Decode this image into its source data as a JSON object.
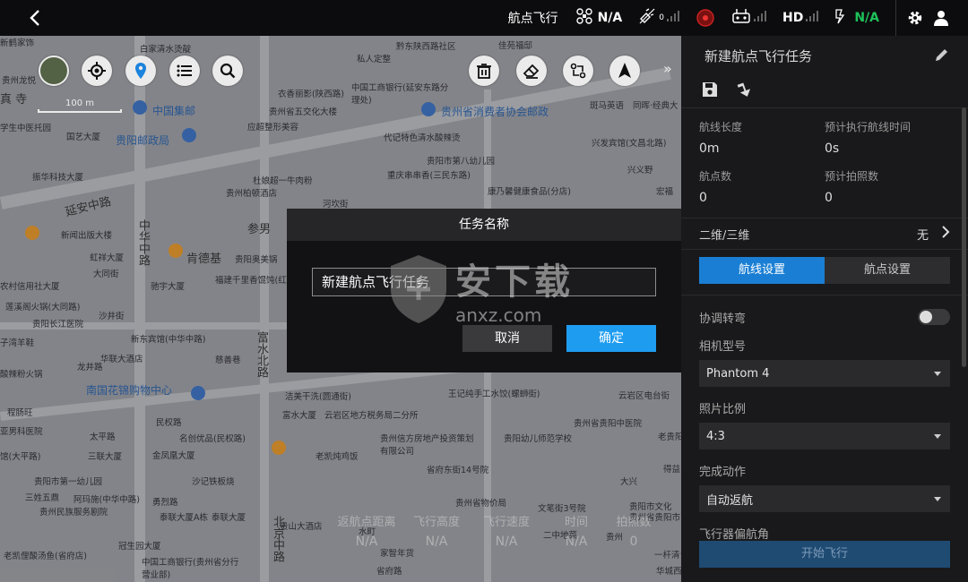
{
  "topbar": {
    "mode_label": "航点飞行",
    "aircraft_value": "N/A",
    "gps_count": "0",
    "hd_label": "HD",
    "battery_value": "N/A"
  },
  "map": {
    "scale_label": "100 m",
    "labels": [
      {
        "t": "白家清水烫靛",
        "c": ""
      },
      {
        "t": "黔东陕西路社区",
        "c": ""
      },
      {
        "t": "佳苑福邸",
        "c": ""
      },
      {
        "t": "贵州龙悦",
        "c": ""
      },
      {
        "t": "华府",
        "c": ""
      },
      {
        "t": "私人定整",
        "c": ""
      },
      {
        "t": "中国工商银行(延安东路分理处)",
        "c": ""
      },
      {
        "t": "衣香丽影(陕西路)",
        "c": ""
      },
      {
        "t": "贵州省五交化大楼",
        "c": ""
      },
      {
        "t": "中国集邮",
        "c": "blue"
      },
      {
        "t": "贵州省消费者协会邮政",
        "c": "blue"
      },
      {
        "t": "斑马英语",
        "c": ""
      },
      {
        "t": "同晖·经典大",
        "c": ""
      },
      {
        "t": "真 寺",
        "c": "big"
      },
      {
        "t": "学生中医托园",
        "c": ""
      },
      {
        "t": "应超整形美容",
        "c": ""
      },
      {
        "t": "代记特色清水酸辣烫",
        "c": ""
      },
      {
        "t": "国艺大厦",
        "c": ""
      },
      {
        "t": "贵阳邮政局",
        "c": "blue"
      },
      {
        "t": "兴发宾馆(文昌北路)",
        "c": ""
      },
      {
        "t": "贵阳市第八幼儿园",
        "c": ""
      },
      {
        "t": "振华科技大厦",
        "c": ""
      },
      {
        "t": "杜娘超一牛肉粉",
        "c": ""
      },
      {
        "t": "重庆串串香(三民东路)",
        "c": ""
      },
      {
        "t": "兴义野",
        "c": ""
      },
      {
        "t": "贵州柏顿酒店",
        "c": ""
      },
      {
        "t": "康乃馨健康食品(分店)",
        "c": ""
      },
      {
        "t": "宏福",
        "c": ""
      },
      {
        "t": "延安中路",
        "c": "big"
      },
      {
        "t": "河坎街",
        "c": ""
      },
      {
        "t": "新闻出版大楼",
        "c": ""
      },
      {
        "t": "参男",
        "c": "big"
      },
      {
        "t": "贵阳奥美锅",
        "c": ""
      },
      {
        "t": "肯德基",
        "c": "big"
      },
      {
        "t": "虹祥大厦",
        "c": ""
      },
      {
        "t": "中华中路",
        "c": "big"
      },
      {
        "t": "大同街",
        "c": ""
      },
      {
        "t": "福建千里香馄饨(红",
        "c": ""
      },
      {
        "t": "驰宇大厦",
        "c": ""
      },
      {
        "t": "农村信用社大厦",
        "c": ""
      },
      {
        "t": "莲溪阁火锅(大同路)",
        "c": ""
      },
      {
        "t": "沙井街",
        "c": ""
      },
      {
        "t": "贵阳长江医院",
        "c": ""
      },
      {
        "t": "新东宾馆(中华中路)",
        "c": ""
      },
      {
        "t": "子湾羊鞋",
        "c": ""
      },
      {
        "t": "华联大酒店",
        "c": ""
      },
      {
        "t": "龙井路",
        "c": ""
      },
      {
        "t": "慈善巷",
        "c": ""
      },
      {
        "t": "富水北路",
        "c": "big"
      },
      {
        "t": "酸辣粉火锅",
        "c": ""
      },
      {
        "t": "南国花锦购物中心",
        "c": "blue"
      },
      {
        "t": "洁美干洗(圆通街)",
        "c": ""
      },
      {
        "t": "王记纯手工水饺(螺蛳街)",
        "c": ""
      },
      {
        "t": "云岩区电台街",
        "c": ""
      },
      {
        "t": "程肠旺",
        "c": ""
      },
      {
        "t": "民权路",
        "c": ""
      },
      {
        "t": "富水大厦",
        "c": ""
      },
      {
        "t": "云岩区地方税务局二分所",
        "c": ""
      },
      {
        "t": "贵州省贵阳中医院",
        "c": ""
      },
      {
        "t": "亚男科医院",
        "c": ""
      },
      {
        "t": "太平路",
        "c": ""
      },
      {
        "t": "名创优品(民权路)",
        "c": ""
      },
      {
        "t": "贵州信方房地产投资策划有限公司",
        "c": ""
      },
      {
        "t": "贵阳幼儿师范学校",
        "c": ""
      },
      {
        "t": "老贵阳",
        "c": ""
      },
      {
        "t": "馆(大平路)",
        "c": ""
      },
      {
        "t": "三联大厦",
        "c": ""
      },
      {
        "t": "金凤凰大厦",
        "c": ""
      },
      {
        "t": "老凯炖鸡饭",
        "c": ""
      },
      {
        "t": "省府东街14号院",
        "c": ""
      },
      {
        "t": "得益",
        "c": ""
      },
      {
        "t": "贵阳市第一幼儿园",
        "c": ""
      },
      {
        "t": "沙记铁板烧",
        "c": ""
      },
      {
        "t": "大兴",
        "c": ""
      },
      {
        "t": "三姓五鼎",
        "c": ""
      },
      {
        "t": "阿玛施(中华中路)",
        "c": ""
      },
      {
        "t": "勇烈路",
        "c": ""
      },
      {
        "t": "贵州省物价局",
        "c": ""
      },
      {
        "t": "文笔街3号院",
        "c": ""
      },
      {
        "t": "贵阳市文化",
        "c": ""
      },
      {
        "t": "贵州民族服务剧院",
        "c": ""
      },
      {
        "t": "泰联大厦A栋",
        "c": ""
      },
      {
        "t": "泰联大厦",
        "c": ""
      },
      {
        "t": "贵州省贵阳市",
        "c": ""
      },
      {
        "t": "贵山大酒店",
        "c": ""
      },
      {
        "t": "水町",
        "c": ""
      },
      {
        "t": "北京中路",
        "c": "big"
      },
      {
        "t": "冠生园大厦",
        "c": ""
      },
      {
        "t": "中国工商银行(贵州省分行营业部)",
        "c": ""
      },
      {
        "t": "省府路",
        "c": ""
      },
      {
        "t": "老凯俚酸汤鱼(省府店)",
        "c": ""
      },
      {
        "t": "一杆清台球室",
        "c": ""
      },
      {
        "t": "华城西",
        "c": ""
      },
      {
        "t": "贵州",
        "c": ""
      },
      {
        "t": "二中地菜",
        "c": ""
      },
      {
        "t": "家智年货",
        "c": ""
      },
      {
        "t": "新鹤家饰",
        "c": ""
      }
    ]
  },
  "map_stats": {
    "items": [
      {
        "k": "返航点距离",
        "v": "N/A"
      },
      {
        "k": "飞行高度",
        "v": "N/A"
      },
      {
        "k": "飞行速度",
        "v": "N/A"
      },
      {
        "k": "时间",
        "v": "N/A"
      },
      {
        "k": "拍照数",
        "v": "0"
      }
    ]
  },
  "dialog": {
    "title": "任务名称",
    "input_value": "新建航点飞行任务",
    "cancel_label": "取消",
    "ok_label": "确定"
  },
  "panel": {
    "title": "新建航点飞行任务",
    "stats": [
      {
        "k": "航线长度",
        "v": "0m"
      },
      {
        "k": "预计执行航线时间",
        "v": "0s"
      },
      {
        "k": "航点数",
        "v": "0"
      },
      {
        "k": "预计拍照数",
        "v": "0"
      }
    ],
    "mode_row_label": "二维/三维",
    "mode_row_value": "无",
    "tab_route": "航线设置",
    "tab_waypoint": "航点设置",
    "coord_turn_label": "协调转弯",
    "camera_label": "相机型号",
    "camera_value": "Phantom 4",
    "ratio_label": "照片比例",
    "ratio_value": "4:3",
    "finish_label": "完成动作",
    "finish_value": "自动返航",
    "yaw_label": "飞行器偏航角",
    "start_label": "开始飞行"
  },
  "watermark": {
    "text": "安下载",
    "sub": "anxz.com"
  },
  "colors": {
    "accent": "#1e9cf0",
    "tab_active": "#1a7fd4",
    "status_green": "#1ec35a"
  }
}
